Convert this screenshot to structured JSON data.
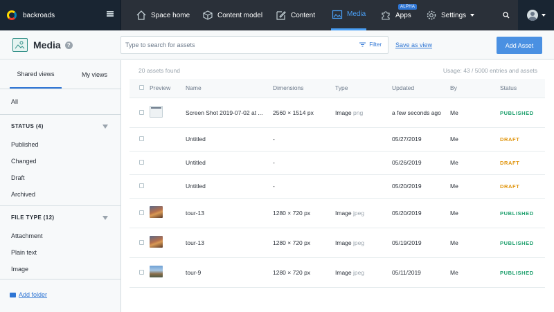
{
  "nav": {
    "space_name": "backroads",
    "items": [
      {
        "label": "Space home"
      },
      {
        "label": "Content model"
      },
      {
        "label": "Content"
      },
      {
        "label": "Media"
      },
      {
        "label": "Apps",
        "badge": "ALPHA"
      },
      {
        "label": "Settings"
      }
    ],
    "active": "Media",
    "accent": "#4a9ff5"
  },
  "header": {
    "title": "Media",
    "search_placeholder": "Type to search for assets",
    "filter_label": "Filter",
    "save_view_label": "Save as view",
    "add_button_label": "Add Asset"
  },
  "sidebar": {
    "tabs": [
      "Shared views",
      "My views"
    ],
    "all_label": "All",
    "status_heading": "STATUS (4)",
    "status_items": [
      "Published",
      "Changed",
      "Draft",
      "Archived"
    ],
    "filetype_heading": "FILE TYPE (12)",
    "filetype_items": [
      "Attachment",
      "Plain text",
      "Image"
    ],
    "add_folder_label": "Add folder"
  },
  "main": {
    "count_text": "20 assets found",
    "usage_text": "Usage: 43 / 5000 entries and assets",
    "columns": [
      "Preview",
      "Name",
      "Dimensions",
      "Type",
      "Updated",
      "By",
      "Status"
    ],
    "rows": [
      {
        "preview": "screenshot",
        "name": "Screen Shot 2019-07-02 at ...",
        "dimensions": "2560 × 1514 px",
        "type": "Image",
        "ext": "png",
        "updated": "a few seconds ago",
        "by": "Me",
        "status": "PUBLISHED"
      },
      {
        "preview": "",
        "name": "Untitled",
        "dimensions": "-",
        "type": "",
        "ext": "",
        "updated": "05/27/2019",
        "by": "Me",
        "status": "DRAFT"
      },
      {
        "preview": "",
        "name": "Untitled",
        "dimensions": "-",
        "type": "",
        "ext": "",
        "updated": "05/26/2019",
        "by": "Me",
        "status": "DRAFT"
      },
      {
        "preview": "",
        "name": "Untitled",
        "dimensions": "-",
        "type": "",
        "ext": "",
        "updated": "05/20/2019",
        "by": "Me",
        "status": "DRAFT"
      },
      {
        "preview": "photo-warm",
        "name": "tour-13",
        "dimensions": "1280 × 720 px",
        "type": "Image",
        "ext": "jpeg",
        "updated": "05/20/2019",
        "by": "Me",
        "status": "PUBLISHED"
      },
      {
        "preview": "photo-warm",
        "name": "tour-13",
        "dimensions": "1280 × 720 px",
        "type": "Image",
        "ext": "jpeg",
        "updated": "05/19/2019",
        "by": "Me",
        "status": "PUBLISHED"
      },
      {
        "preview": "photo-cool",
        "name": "tour-9",
        "dimensions": "1280 × 720 px",
        "type": "Image",
        "ext": "jpeg",
        "updated": "05/11/2019",
        "by": "Me",
        "status": "PUBLISHED"
      }
    ]
  },
  "colors": {
    "published": "#1fa06e",
    "draft": "#e0940c",
    "primary_button": "#4a90e2",
    "topbar": "#2a3039"
  }
}
